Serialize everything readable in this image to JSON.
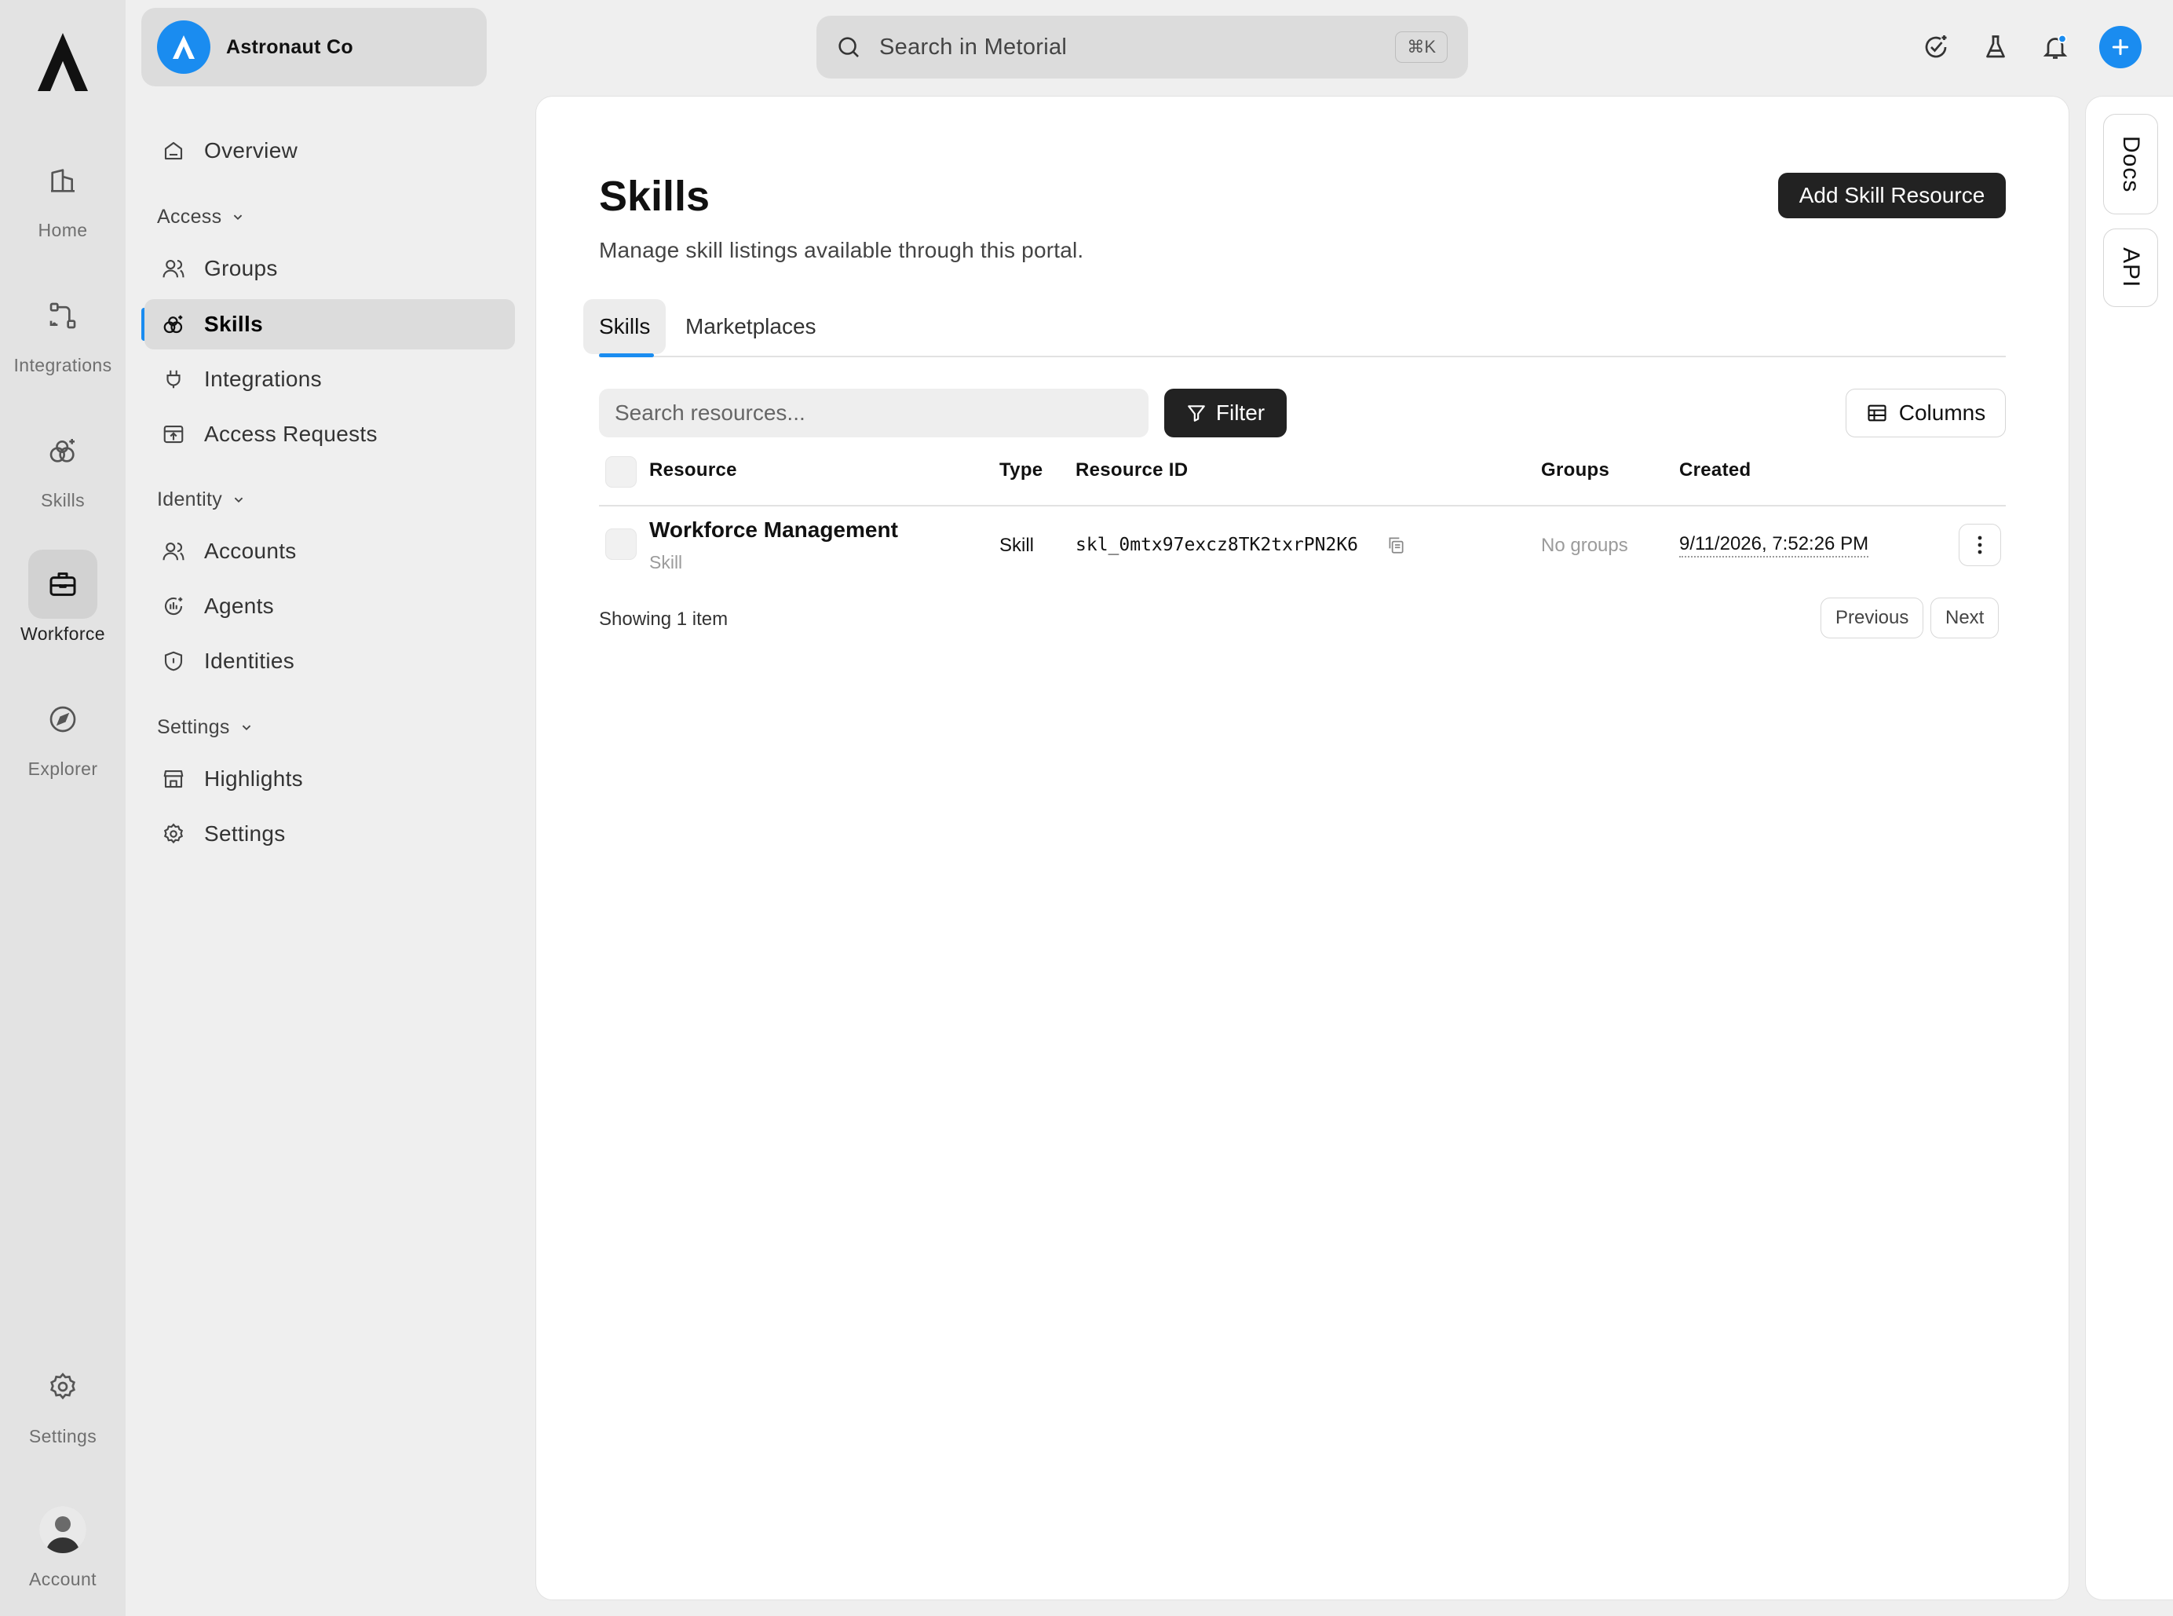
{
  "rail": {
    "items": [
      {
        "label": "Home",
        "icon": "building-icon"
      },
      {
        "label": "Integrations",
        "icon": "integrations-icon"
      },
      {
        "label": "Skills",
        "icon": "skills-icon"
      },
      {
        "label": "Workforce",
        "icon": "briefcase-icon",
        "active": true
      },
      {
        "label": "Explorer",
        "icon": "compass-icon"
      }
    ],
    "settings_label": "Settings",
    "account_label": "Account"
  },
  "org": {
    "name": "Astronaut Co"
  },
  "sidebar": {
    "overview": "Overview",
    "sections": {
      "access": "Access",
      "identity": "Identity",
      "settings": "Settings"
    },
    "items": {
      "groups": "Groups",
      "skills": "Skills",
      "integrations": "Integrations",
      "access_requests": "Access Requests",
      "accounts": "Accounts",
      "agents": "Agents",
      "identities": "Identities",
      "highlights": "Highlights",
      "settings": "Settings"
    }
  },
  "topbar": {
    "search_placeholder": "Search in Metorial",
    "shortcut": "⌘K"
  },
  "page": {
    "title": "Skills",
    "subtitle": "Manage skill listings available through this portal.",
    "add_button": "Add Skill Resource",
    "tabs": [
      "Skills",
      "Marketplaces"
    ],
    "search_placeholder": "Search resources...",
    "filter_label": "Filter",
    "columns_label": "Columns"
  },
  "table": {
    "headers": {
      "resource": "Resource",
      "type": "Type",
      "resource_id": "Resource ID",
      "groups": "Groups",
      "created": "Created"
    },
    "rows": [
      {
        "name": "Workforce Management",
        "kind": "Skill",
        "type": "Skill",
        "resource_id": "skl_0mtx97excz8TK2txrPN2K6",
        "groups": "No groups",
        "created": "9/11/2026, 7:52:26 PM"
      }
    ],
    "footer": "Showing 1 item",
    "previous": "Previous",
    "next": "Next"
  },
  "docs_panel": {
    "docs": "Docs",
    "api": "API"
  },
  "colors": {
    "accent": "#1a8cf0",
    "dark_button": "#222222"
  }
}
